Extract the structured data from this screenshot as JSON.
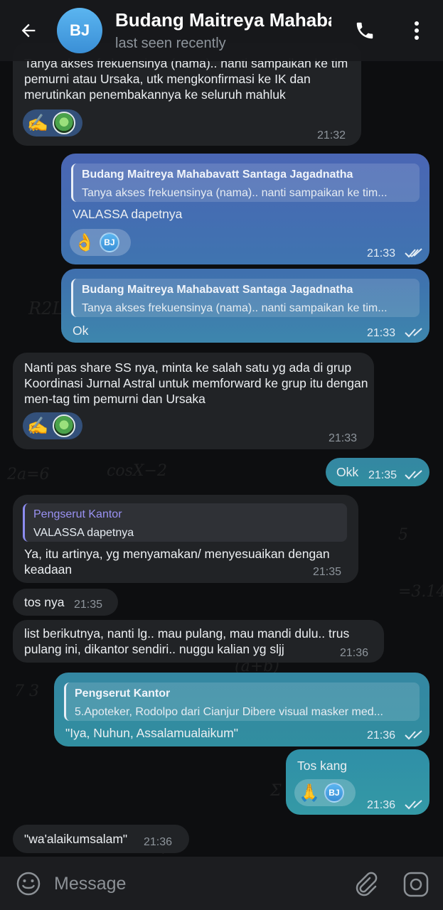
{
  "header": {
    "avatar_initials": "BJ",
    "title": "Budang Maitreya Mahabavatt Santaga Jagadnatha",
    "status": "last seen recently",
    "back_icon": "arrow-left-icon",
    "call_icon": "phone-icon",
    "more_icon": "more-vertical-icon"
  },
  "messages": [
    {
      "direction": "in",
      "text": "Tanya akses frekuensinya (nama).. nanti sampaikan ke tim pemurni atau Ursaka, utk mengkonfirmasi ke IK dan merutinkan penembakannya ke seluruh mahluk",
      "reactions": [
        "✍️",
        "alien-avatar"
      ],
      "time": "21:32"
    },
    {
      "direction": "out",
      "reply_to": {
        "name": "Budang Maitreya Mahabavatt Santaga Jagadnatha",
        "text": "Tanya akses frekuensinya (nama).. nanti sampaikan ke tim..."
      },
      "text": "VALASSA dapetnya",
      "reactions": [
        "👌",
        "BJ"
      ],
      "time": "21:33",
      "status": "read"
    },
    {
      "direction": "out",
      "reply_to": {
        "name": "Budang Maitreya Mahabavatt Santaga Jagadnatha",
        "text": "Tanya akses frekuensinya (nama).. nanti sampaikan ke tim..."
      },
      "text": "Ok",
      "time": "21:33",
      "status": "read"
    },
    {
      "direction": "in",
      "text": "Nanti pas share SS nya, minta ke salah satu yg ada di grup Koordinasi Jurnal Astral untuk memforward ke grup itu dengan men-tag tim pemurni dan Ursaka",
      "reactions": [
        "✍️",
        "alien-avatar"
      ],
      "time": "21:33"
    },
    {
      "direction": "out",
      "text": "Okk",
      "time": "21:35",
      "status": "read"
    },
    {
      "direction": "in",
      "reply_to": {
        "name": "Pengserut Kantor",
        "text": "VALASSA dapetnya"
      },
      "text": "Ya, itu artinya, yg menyamakan/ menyesuaikan dengan keadaan",
      "time": "21:35"
    },
    {
      "direction": "in",
      "text": "tos nya",
      "time": "21:35"
    },
    {
      "direction": "in",
      "text": "list berikutnya, nanti lg.. mau pulang, mau mandi dulu.. trus pulang ini, dikantor sendiri.. nuggu kalian yg sljj",
      "time": "21:36"
    },
    {
      "direction": "out",
      "reply_to": {
        "name": "Pengserut Kantor",
        "text": "5.Apoteker, Rodolpo dari Cianjur  Dibere visual masker med..."
      },
      "text": "\"Iya, Nuhun, Assalamualaikum\"",
      "time": "21:36",
      "status": "read"
    },
    {
      "direction": "out",
      "text": "Tos kang",
      "reactions": [
        "🙏",
        "BJ"
      ],
      "time": "21:36",
      "status": "read"
    },
    {
      "direction": "in",
      "text": "\"wa'alaikumsalam\"",
      "time": "21:36"
    }
  ],
  "composer": {
    "placeholder": "Message",
    "emoji_icon": "smiley-icon",
    "attach_icon": "paperclip-icon",
    "camera_icon": "camera-icon"
  },
  "colors": {
    "background": "#0d0e10",
    "incoming_bubble": "#212326",
    "outgoing_bubble_blue": "#4a66b4",
    "outgoing_bubble_teal": "#3487a2",
    "avatar": "#4aa3e3"
  }
}
